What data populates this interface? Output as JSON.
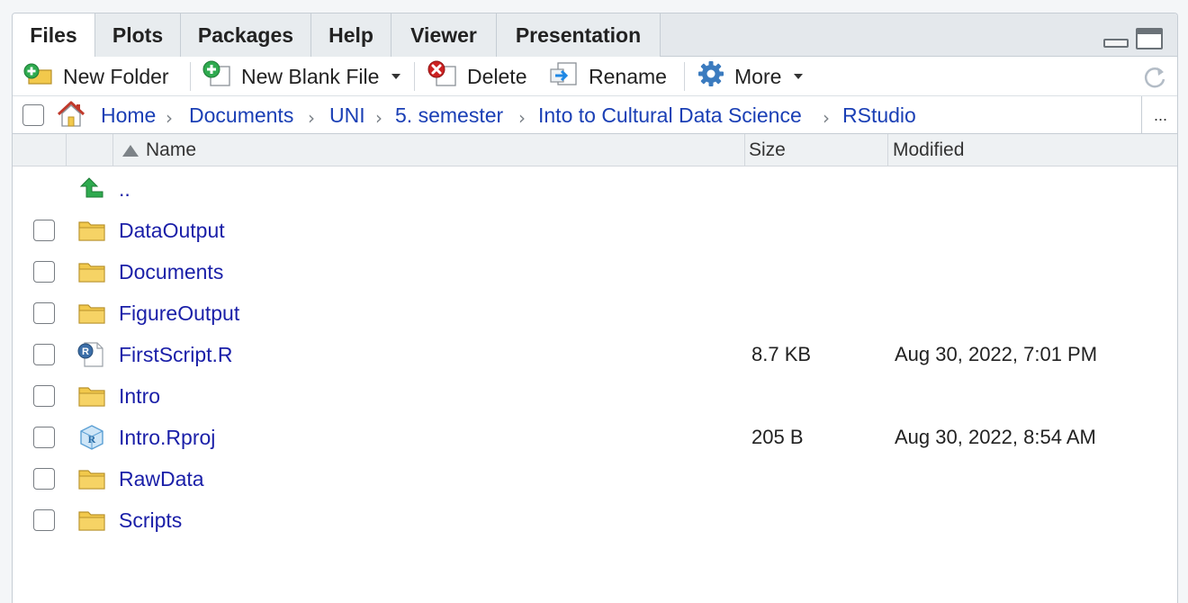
{
  "tabs": [
    {
      "label": "Files",
      "active": true
    },
    {
      "label": "Plots"
    },
    {
      "label": "Packages"
    },
    {
      "label": "Help"
    },
    {
      "label": "Viewer"
    },
    {
      "label": "Presentation"
    }
  ],
  "toolbar": {
    "new_folder": "New Folder",
    "new_blank_file": "New Blank File",
    "delete": "Delete",
    "rename": "Rename",
    "more": "More"
  },
  "breadcrumb": [
    "Home",
    "Documents",
    "UNI",
    "5. semester",
    "Into to Cultural Data Science",
    "RStudio"
  ],
  "breadcrumb_more": "...",
  "columns": {
    "name": "Name",
    "size": "Size",
    "modified": "Modified"
  },
  "files": [
    {
      "name": "..",
      "type": "parent",
      "size": "",
      "modified": ""
    },
    {
      "name": "DataOutput",
      "type": "folder",
      "size": "",
      "modified": ""
    },
    {
      "name": "Documents",
      "type": "folder",
      "size": "",
      "modified": ""
    },
    {
      "name": "FigureOutput",
      "type": "folder",
      "size": "",
      "modified": ""
    },
    {
      "name": "FirstScript.R",
      "type": "r-script",
      "size": "8.7 KB",
      "modified": "Aug 30, 2022, 7:01 PM"
    },
    {
      "name": "Intro",
      "type": "folder",
      "size": "",
      "modified": ""
    },
    {
      "name": "Intro.Rproj",
      "type": "rproj",
      "size": "205 B",
      "modified": "Aug 30, 2022, 8:54 AM"
    },
    {
      "name": "RawData",
      "type": "folder",
      "size": "",
      "modified": ""
    },
    {
      "name": "Scripts",
      "type": "folder",
      "size": "",
      "modified": ""
    }
  ],
  "colors": {
    "link": "#1a1fa8",
    "breadcrumb": "#1a3fb5",
    "folder": "#f2c94c",
    "parent_arrow": "#2faa4f",
    "delete": "#cc2222"
  }
}
